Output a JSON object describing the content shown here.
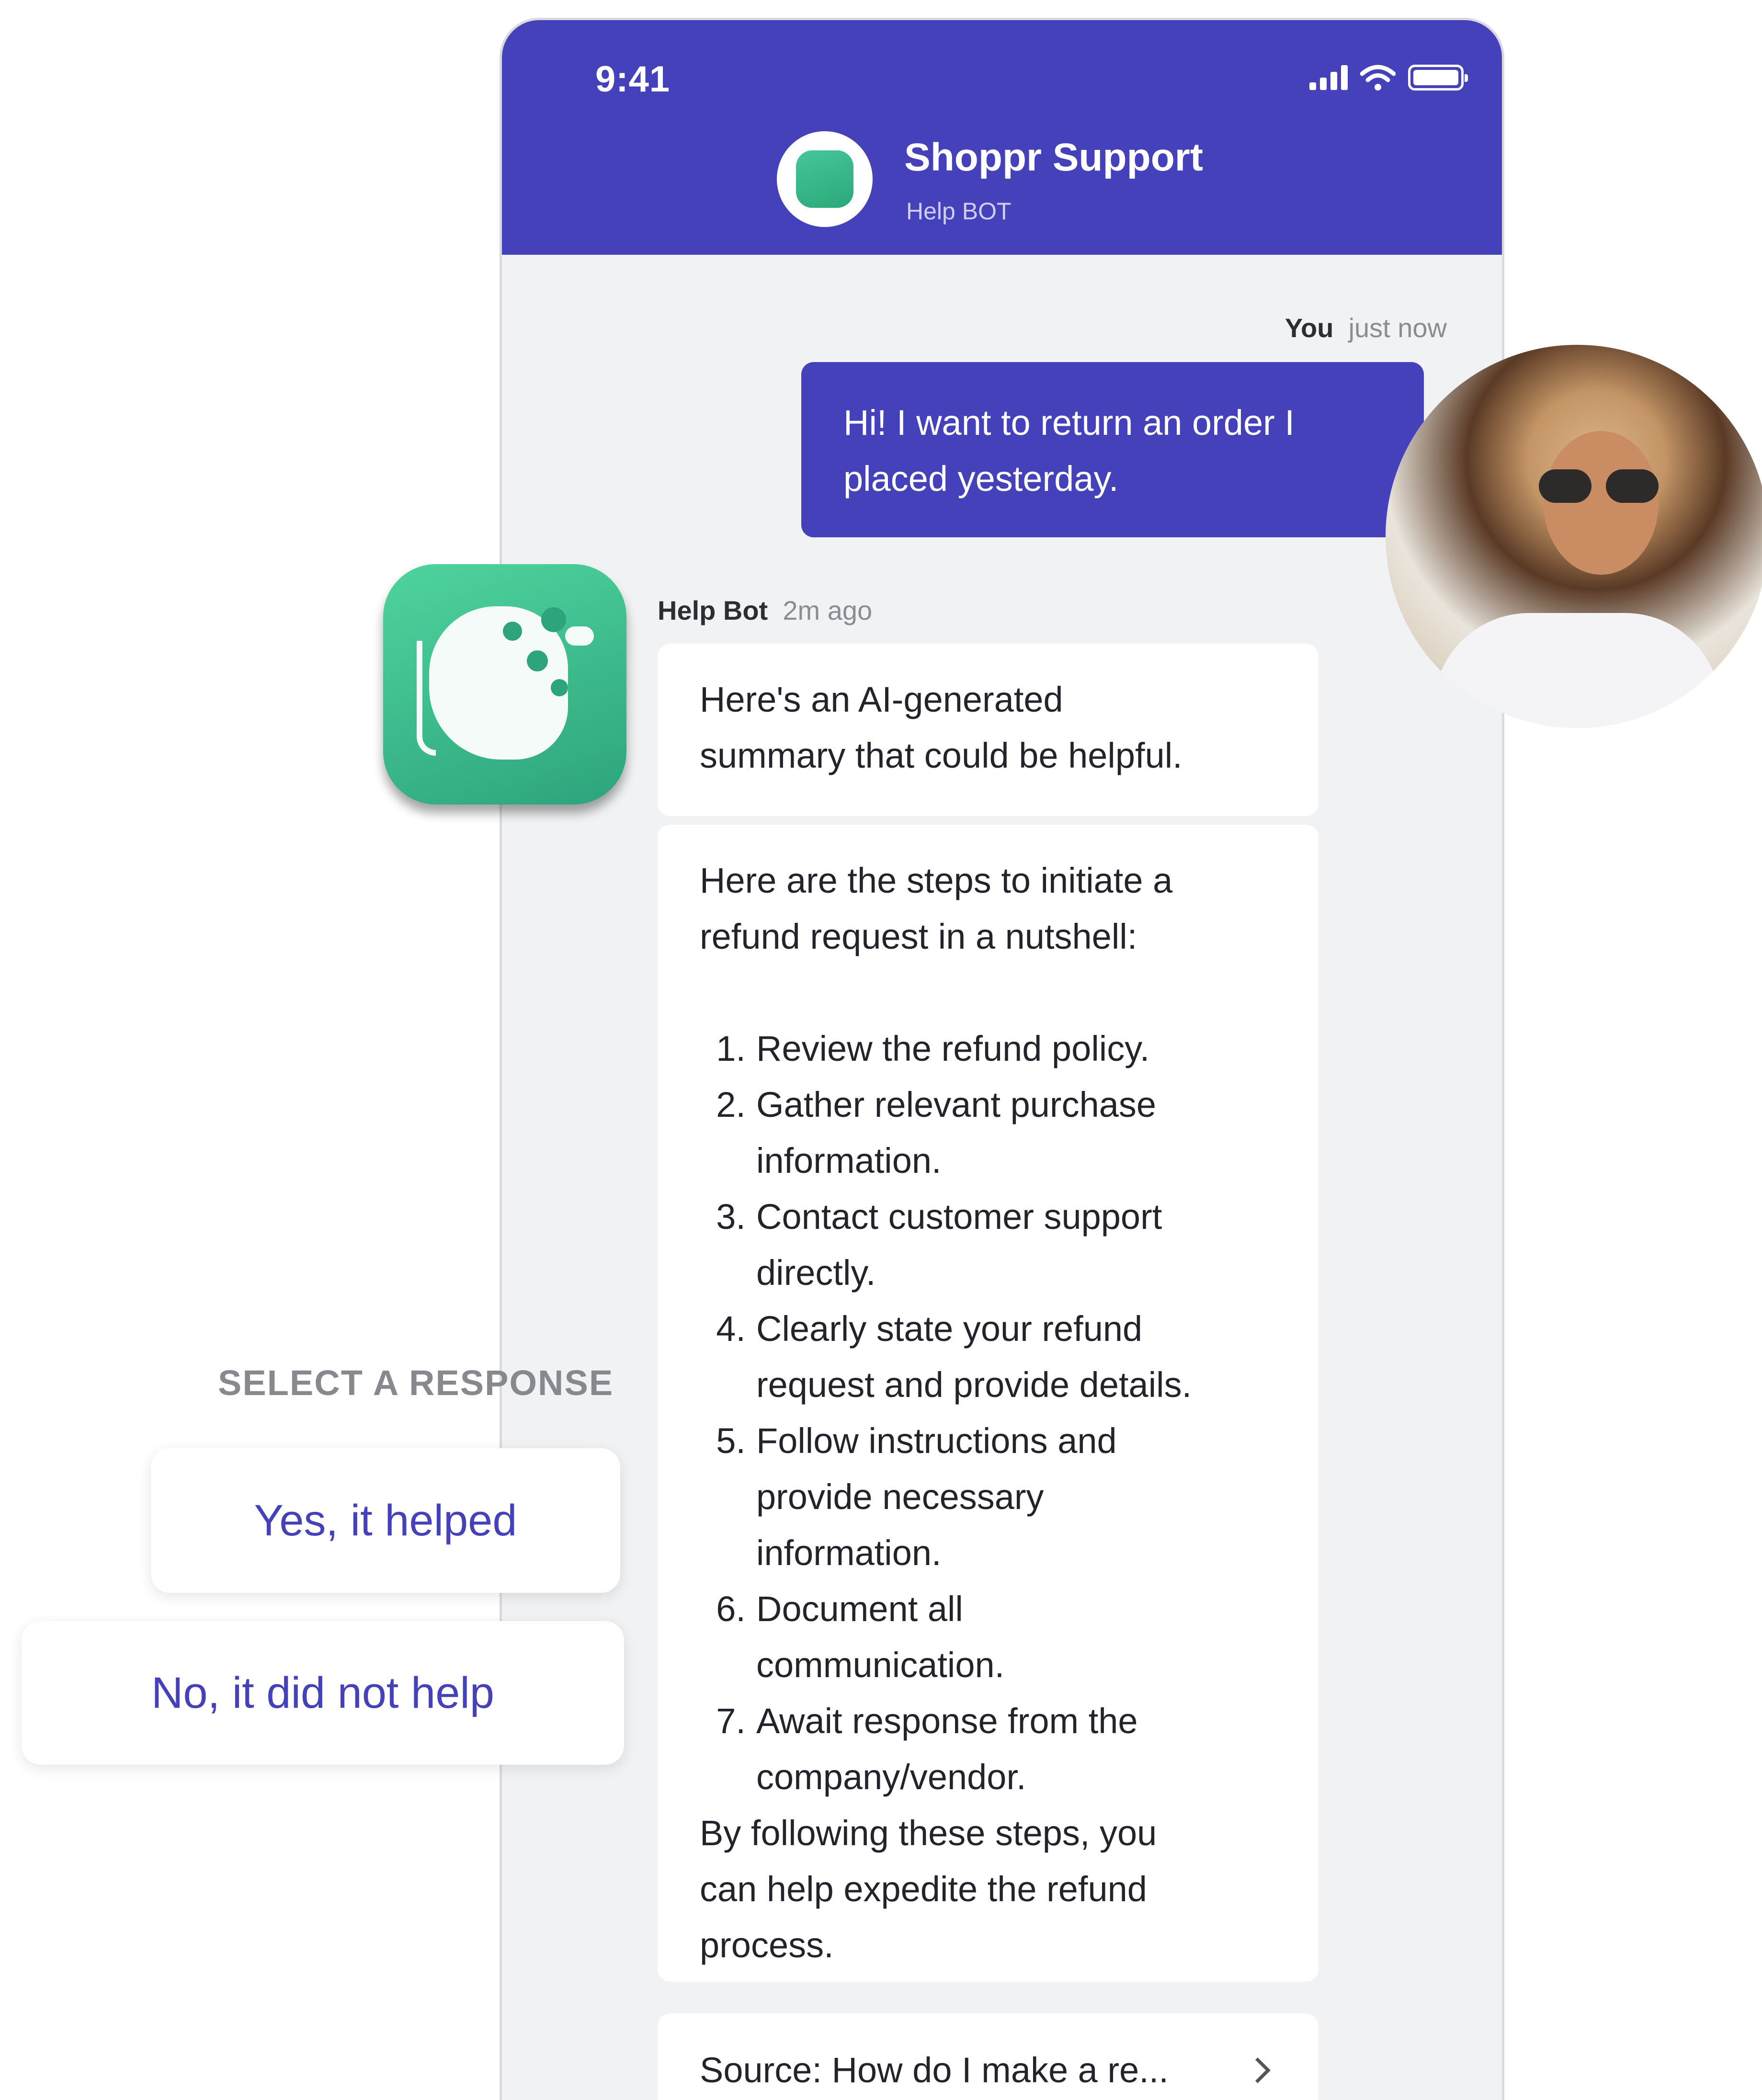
{
  "status_bar": {
    "time": "9:41"
  },
  "header": {
    "title": "Shoppr Support",
    "subtitle": "Help BOT"
  },
  "messages": {
    "user": {
      "sender": "You",
      "time": "just now",
      "text_line1": "Hi! I want to return an order I",
      "text_line2": "placed yesterday."
    },
    "bot": {
      "sender": "Help Bot",
      "time": "2m ago"
    },
    "bot_intro": {
      "line1": "Here's an AI-generated",
      "line2": "summary that could be helpful."
    },
    "summary": {
      "intro_line1": "Here are the steps to initiate a",
      "intro_line2": "refund request in a nutshell:",
      "steps": [
        {
          "num": "1.",
          "lines": [
            "Review the refund policy."
          ]
        },
        {
          "num": "2.",
          "lines": [
            "Gather relevant purchase",
            "information."
          ]
        },
        {
          "num": "3.",
          "lines": [
            "Contact customer support",
            "directly."
          ]
        },
        {
          "num": "4.",
          "lines": [
            "Clearly state your refund",
            "request and provide details."
          ]
        },
        {
          "num": "5.",
          "lines": [
            "Follow instructions and",
            "provide necessary",
            "information."
          ]
        },
        {
          "num": "6.",
          "lines": [
            "Document all",
            "communication."
          ]
        },
        {
          "num": "7.",
          "lines": [
            "Await response from the",
            "company/vendor."
          ]
        }
      ],
      "outro_line1": "By following these steps, you",
      "outro_line2": "can help expedite the refund",
      "outro_line3": "process."
    },
    "source": {
      "text": "Source: How do I make a re..."
    }
  },
  "responses": {
    "label": "SELECT A RESPONSE",
    "yes": "Yes, it helped",
    "no": "No, it did not help"
  },
  "colors": {
    "brand": "#4541bb",
    "bot_green": "#2da47c",
    "chat_bg": "#f1f2f4"
  },
  "icons": {
    "bot": "bot-head-icon",
    "chevron": "chevron-right-icon"
  }
}
